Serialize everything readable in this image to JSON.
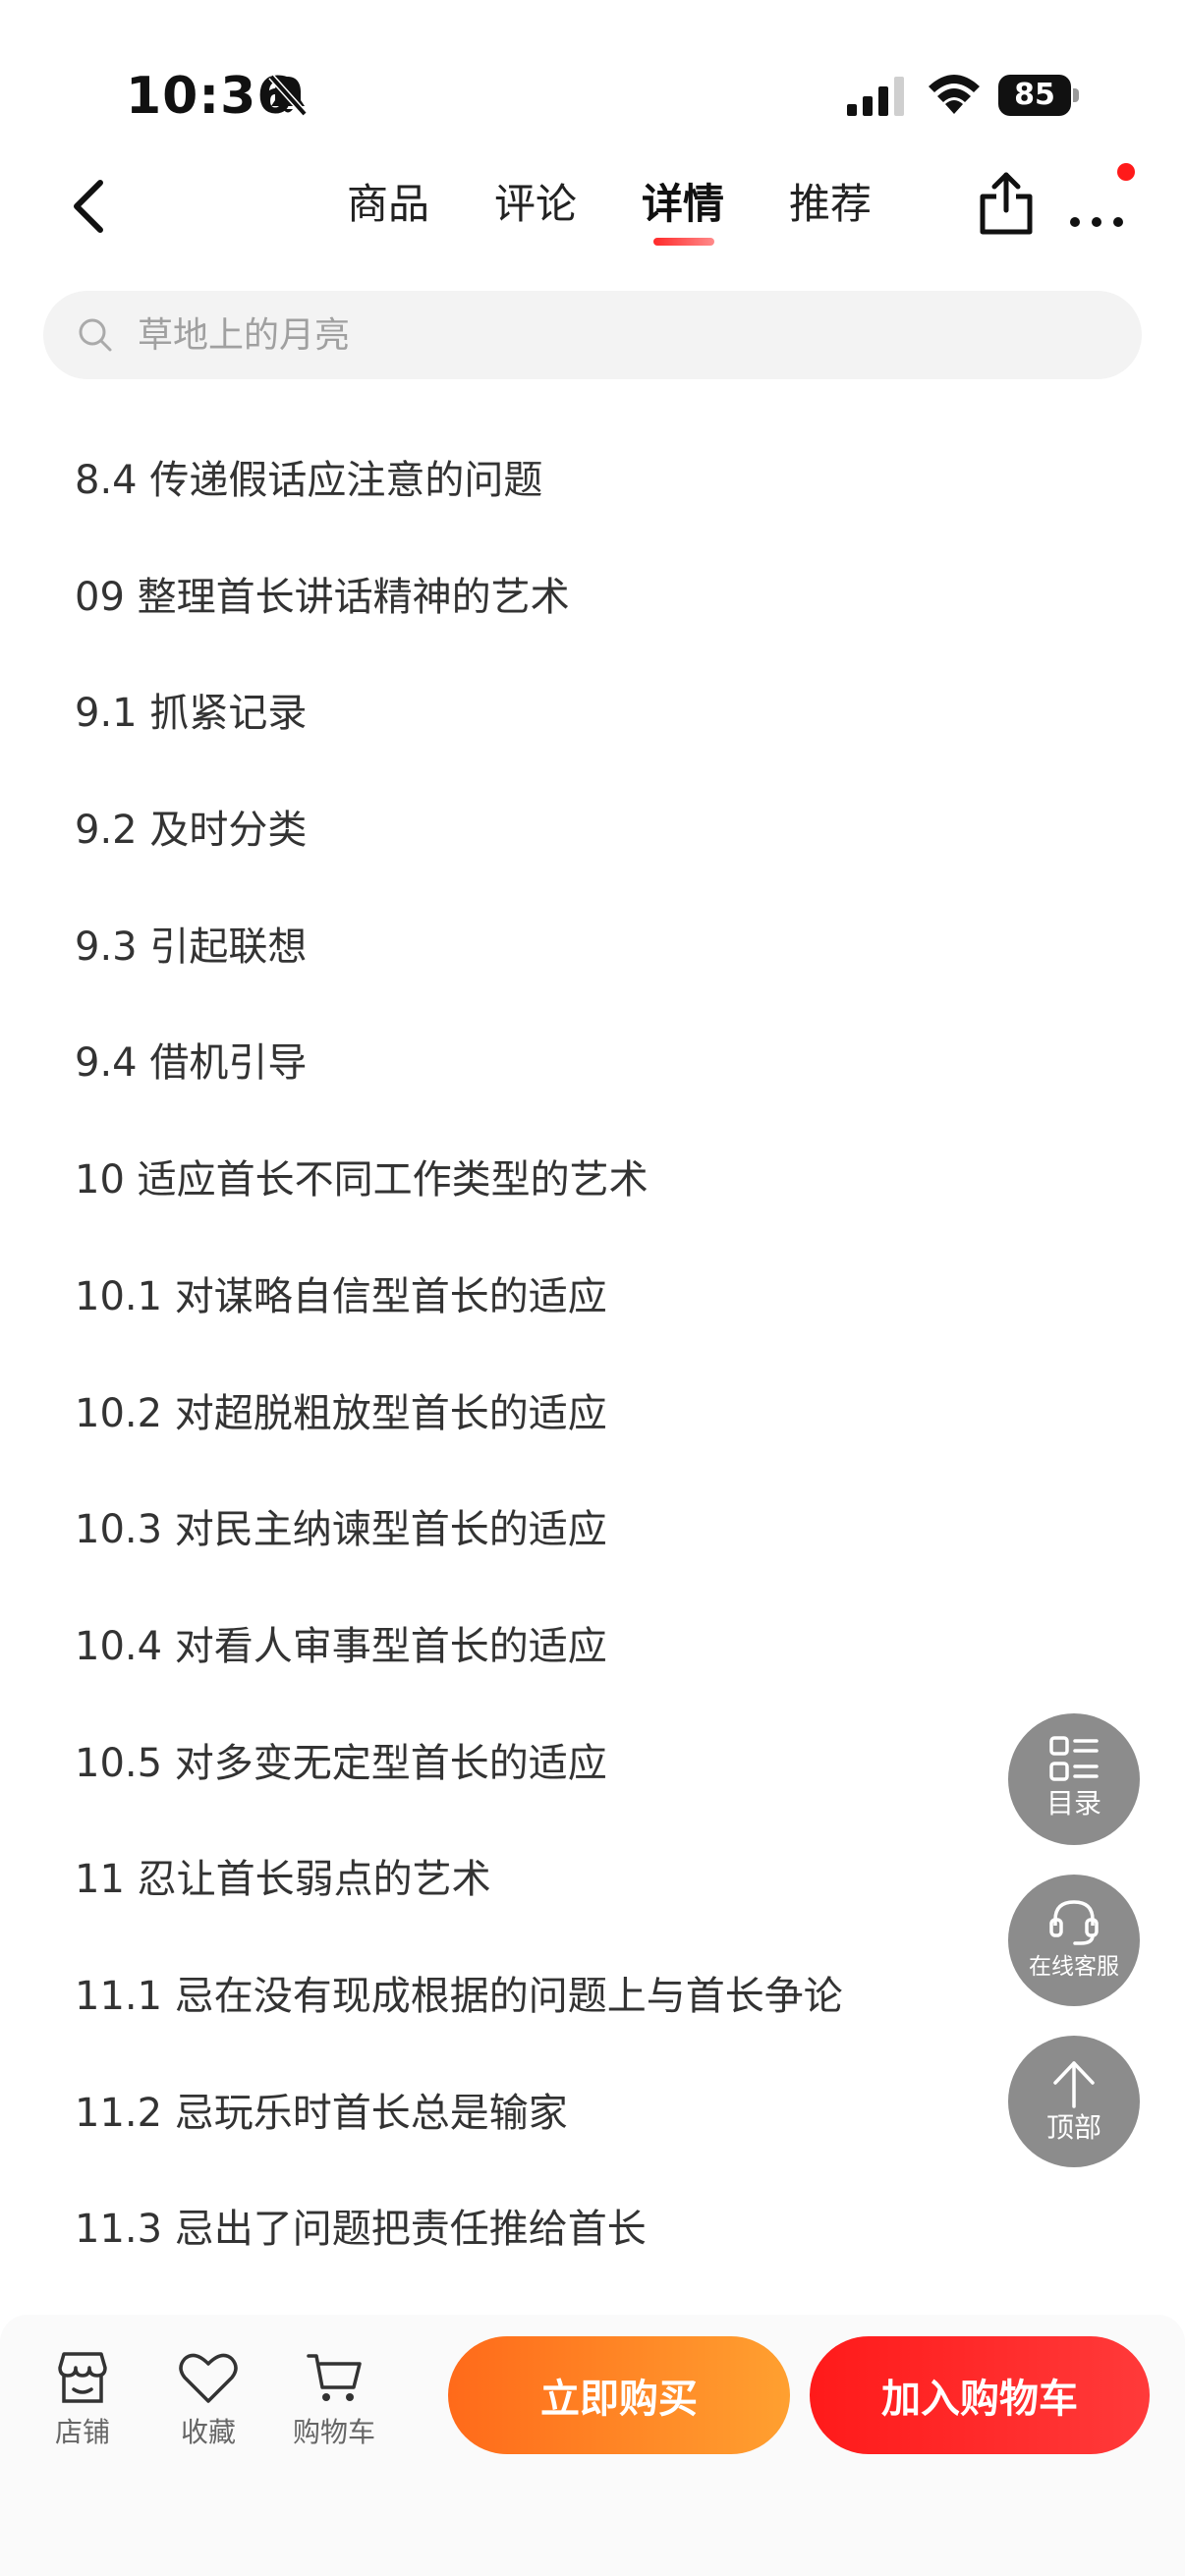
{
  "status_bar": {
    "time": "10:36",
    "battery": "85"
  },
  "nav": {
    "tabs": [
      {
        "label": "商品"
      },
      {
        "label": "评论"
      },
      {
        "label": "详情",
        "active": true
      },
      {
        "label": "推荐"
      }
    ],
    "accent_color": "#ff2a2a"
  },
  "search": {
    "placeholder": "草地上的月亮"
  },
  "toc": {
    "items": [
      "8.4 传递假话应注意的问题",
      "09 整理首长讲话精神的艺术",
      "9.1 抓紧记录",
      "9.2 及时分类",
      "9.3 引起联想",
      "9.4 借机引导",
      "10 适应首长不同工作类型的艺术",
      "10.1 对谋略自信型首长的适应",
      "10.2 对超脱粗放型首长的适应",
      "10.3 对民主纳谏型首长的适应",
      "10.4 对看人审事型首长的适应",
      "10.5 对多变无定型首长的适应",
      "11 忍让首长弱点的艺术",
      "11.1 忌在没有现成根据的问题上与首长争论",
      "11.2 忌玩乐时首长总是输家",
      "11.3 忌出了问题把责任推给首长"
    ]
  },
  "floating": {
    "toc_label": "目录",
    "service_label": "在线客服",
    "top_label": "顶部"
  },
  "bottom": {
    "store_label": "店铺",
    "favorite_label": "收藏",
    "cart_label": "购物车",
    "buy_now_label": "立即购买",
    "add_cart_label": "加入购物车",
    "buy_color": "#ff6a1a",
    "cart_color": "#ff1a1a"
  }
}
